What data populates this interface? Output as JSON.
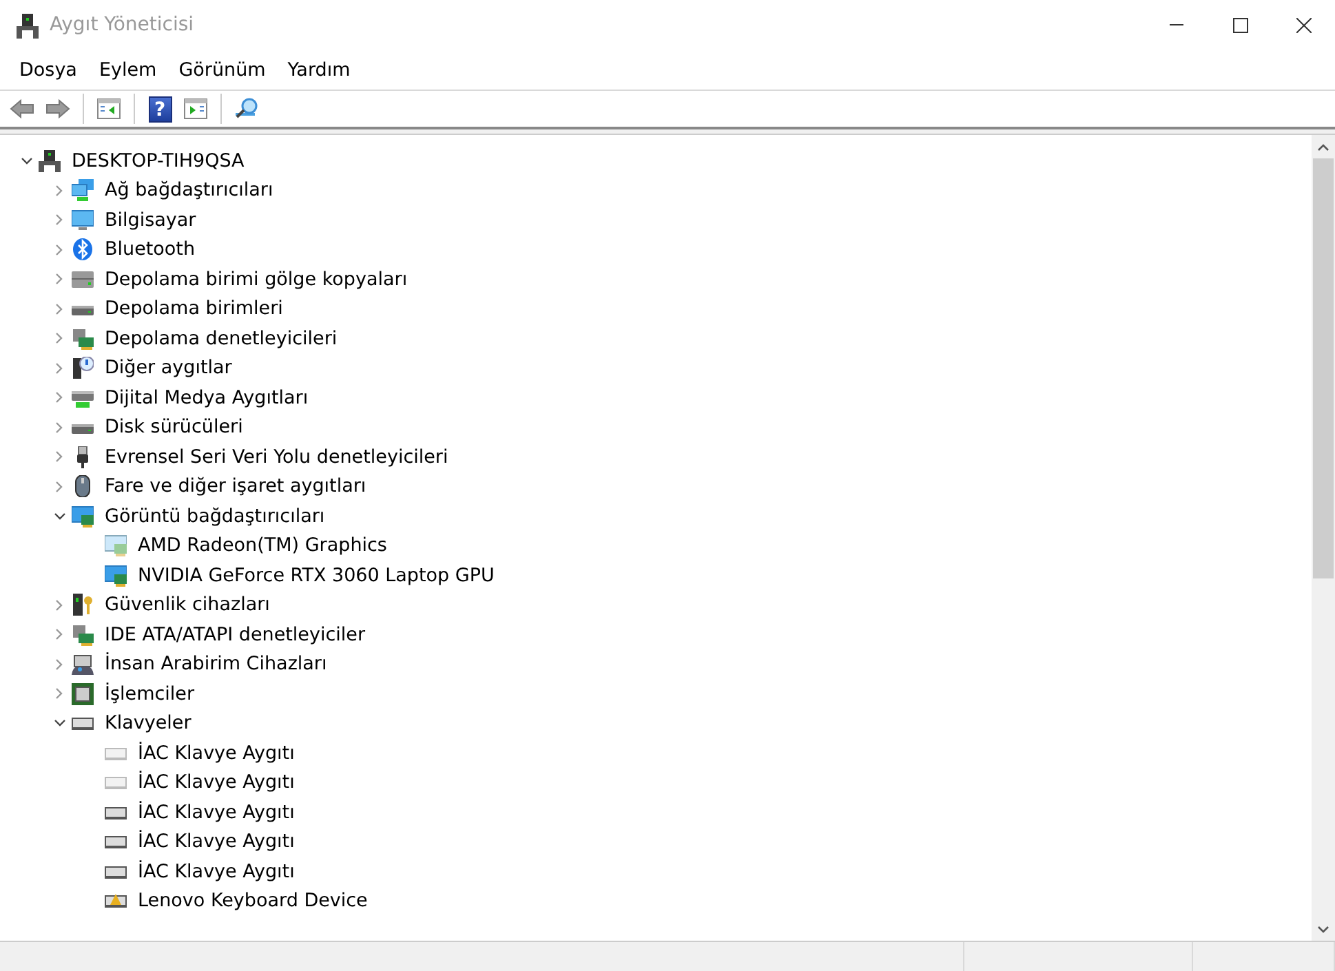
{
  "window": {
    "title": "Aygıt Yöneticisi"
  },
  "menu": [
    "Dosya",
    "Eylem",
    "Görünüm",
    "Yardım"
  ],
  "toolbar": [
    {
      "kind": "back"
    },
    {
      "kind": "forward"
    },
    {
      "kind": "sep"
    },
    {
      "kind": "tree"
    },
    {
      "kind": "sep"
    },
    {
      "kind": "help",
      "label": "?"
    },
    {
      "kind": "pane"
    },
    {
      "kind": "sep"
    },
    {
      "kind": "scan"
    }
  ],
  "tree": {
    "label": "DESKTOP-TIH9QSA",
    "kind": "pc",
    "expanded": true,
    "children": [
      {
        "label": "Ağ bağdaştırıcıları",
        "kind": "network",
        "expanded": false
      },
      {
        "label": "Bilgisayar",
        "kind": "monitor",
        "expanded": false
      },
      {
        "label": "Bluetooth",
        "kind": "bluetooth",
        "expanded": false
      },
      {
        "label": "Depolama birimi gölge kopyaları",
        "kind": "drive",
        "expanded": false
      },
      {
        "label": "Depolama birimleri",
        "kind": "disk",
        "expanded": false
      },
      {
        "label": "Depolama denetleyicileri",
        "kind": "controller",
        "expanded": false
      },
      {
        "label": "Diğer aygıtlar",
        "kind": "unknown",
        "expanded": false
      },
      {
        "label": "Dijital Medya Aygıtları",
        "kind": "media",
        "expanded": false
      },
      {
        "label": "Disk sürücüleri",
        "kind": "disk",
        "expanded": false
      },
      {
        "label": "Evrensel Seri Veri Yolu denetleyicileri",
        "kind": "usb",
        "expanded": false
      },
      {
        "label": "Fare ve diğer işaret aygıtları",
        "kind": "mouse",
        "expanded": false
      },
      {
        "label": "Görüntü bağdaştırıcıları",
        "kind": "display",
        "expanded": true,
        "children": [
          {
            "label": "AMD Radeon(TM) Graphics",
            "kind": "display-light"
          },
          {
            "label": "NVIDIA GeForce RTX 3060 Laptop GPU",
            "kind": "display"
          }
        ]
      },
      {
        "label": "Güvenlik cihazları",
        "kind": "security",
        "expanded": false
      },
      {
        "label": "IDE ATA/ATAPI denetleyiciler",
        "kind": "controller",
        "expanded": false
      },
      {
        "label": "İnsan Arabirim Cihazları",
        "kind": "hid",
        "expanded": false
      },
      {
        "label": "İşlemciler",
        "kind": "cpu",
        "expanded": false
      },
      {
        "label": "Klavyeler",
        "kind": "keyboard",
        "expanded": true,
        "children": [
          {
            "label": "İAC Klavye Aygıtı",
            "kind": "keyboard-light"
          },
          {
            "label": "İAC Klavye Aygıtı",
            "kind": "keyboard-light"
          },
          {
            "label": "İAC Klavye Aygıtı",
            "kind": "keyboard"
          },
          {
            "label": "İAC Klavye Aygıtı",
            "kind": "keyboard"
          },
          {
            "label": "İAC Klavye Aygıtı",
            "kind": "keyboard"
          },
          {
            "label": "Lenovo Keyboard Device",
            "kind": "keyboard-warn"
          }
        ]
      }
    ]
  }
}
